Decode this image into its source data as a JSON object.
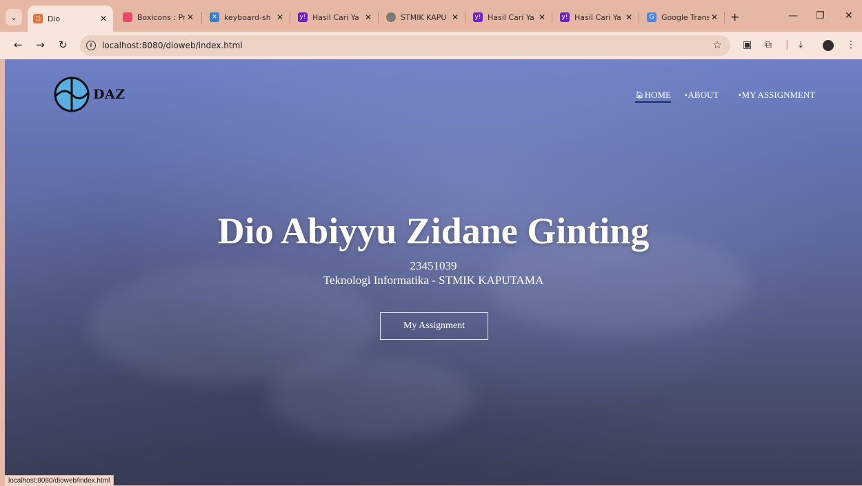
{
  "browser": {
    "tabs": [
      {
        "title": "Dio",
        "favicon_color": "#e0733f",
        "active": true
      },
      {
        "title": "Boxicons : Pr",
        "favicon_color": "#e84a6a",
        "active": false
      },
      {
        "title": "keyboard-sh",
        "favicon_color": "#2f80d1",
        "active": false
      },
      {
        "title": "Hasil Cari Ya",
        "favicon_color": "#6a1fd1",
        "active": false
      },
      {
        "title": "STMIK KAPU",
        "favicon_color": "#7a7a7a",
        "active": false
      },
      {
        "title": "Hasil Cari Ya",
        "favicon_color": "#6a1fd1",
        "active": false
      },
      {
        "title": "Hasil Cari Ya",
        "favicon_color": "#6a1fd1",
        "active": false
      },
      {
        "title": "Google Trans",
        "favicon_color": "#4a86e8",
        "active": false
      }
    ],
    "close_glyph": "✕",
    "new_tab_glyph": "+",
    "url": "localhost:8080/dioweb/index.html",
    "status_url": "localhost:8080/dioweb/index.html"
  },
  "site": {
    "brand": "DAZ",
    "nav": [
      {
        "label": "HOME",
        "active": true
      },
      {
        "label": "ABOUT",
        "active": false
      },
      {
        "label": "MY ASSIGNMENT",
        "active": false
      }
    ],
    "hero": {
      "name": "Dio Abiyyu Zidane Ginting",
      "student_id": "23451039",
      "program": "Teknologi Informatika - STMIK KAPUTAMA",
      "button": "My Assignment"
    }
  },
  "colors": {
    "tabstrip": "#e6b7a3",
    "toolbar": "#f8e6dd",
    "hero_top": "#6e80c6",
    "hero_bottom": "#3a3e56",
    "nav_underline": "#222a66"
  }
}
